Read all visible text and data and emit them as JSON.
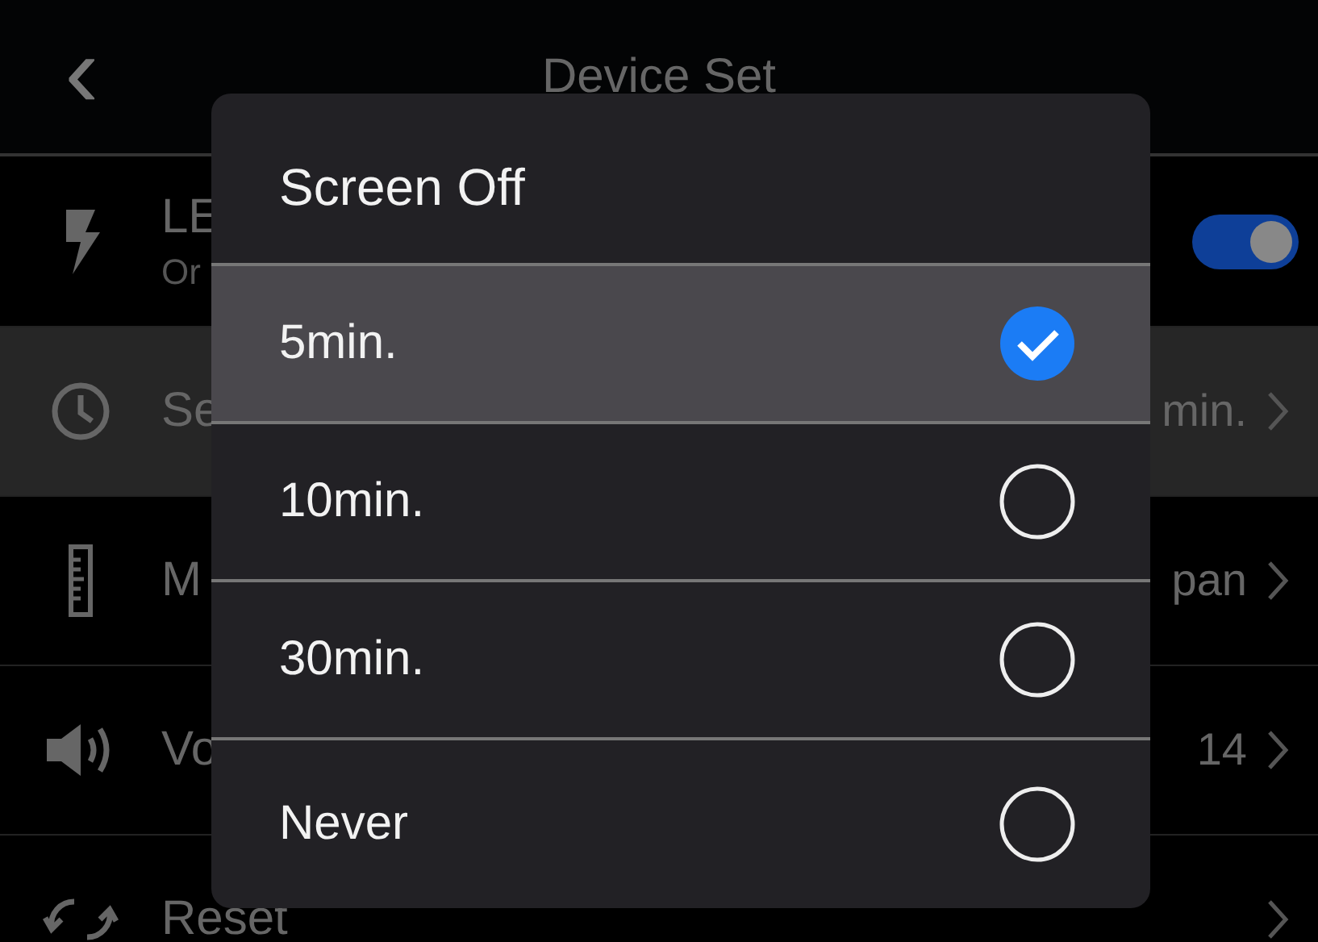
{
  "header": {
    "back": "‹",
    "title": "Device Set"
  },
  "rows": [
    {
      "kind": "toggle",
      "label": "LE",
      "sublabel": "Or",
      "on": true,
      "selected": false
    },
    {
      "kind": "value",
      "label": "Se",
      "value": "min.",
      "selected": true
    },
    {
      "kind": "value",
      "label": "M",
      "value": "pan",
      "selected": false
    },
    {
      "kind": "value",
      "label": "Vo",
      "value": "14",
      "selected": false
    },
    {
      "kind": "value",
      "label": "Reset",
      "selected": false
    }
  ],
  "dialog": {
    "title": "Screen Off",
    "options": [
      {
        "label": "5min.",
        "selected": true
      },
      {
        "label": "10min.",
        "selected": false
      },
      {
        "label": "30min.",
        "selected": false
      },
      {
        "label": "Never",
        "selected": false
      }
    ]
  }
}
